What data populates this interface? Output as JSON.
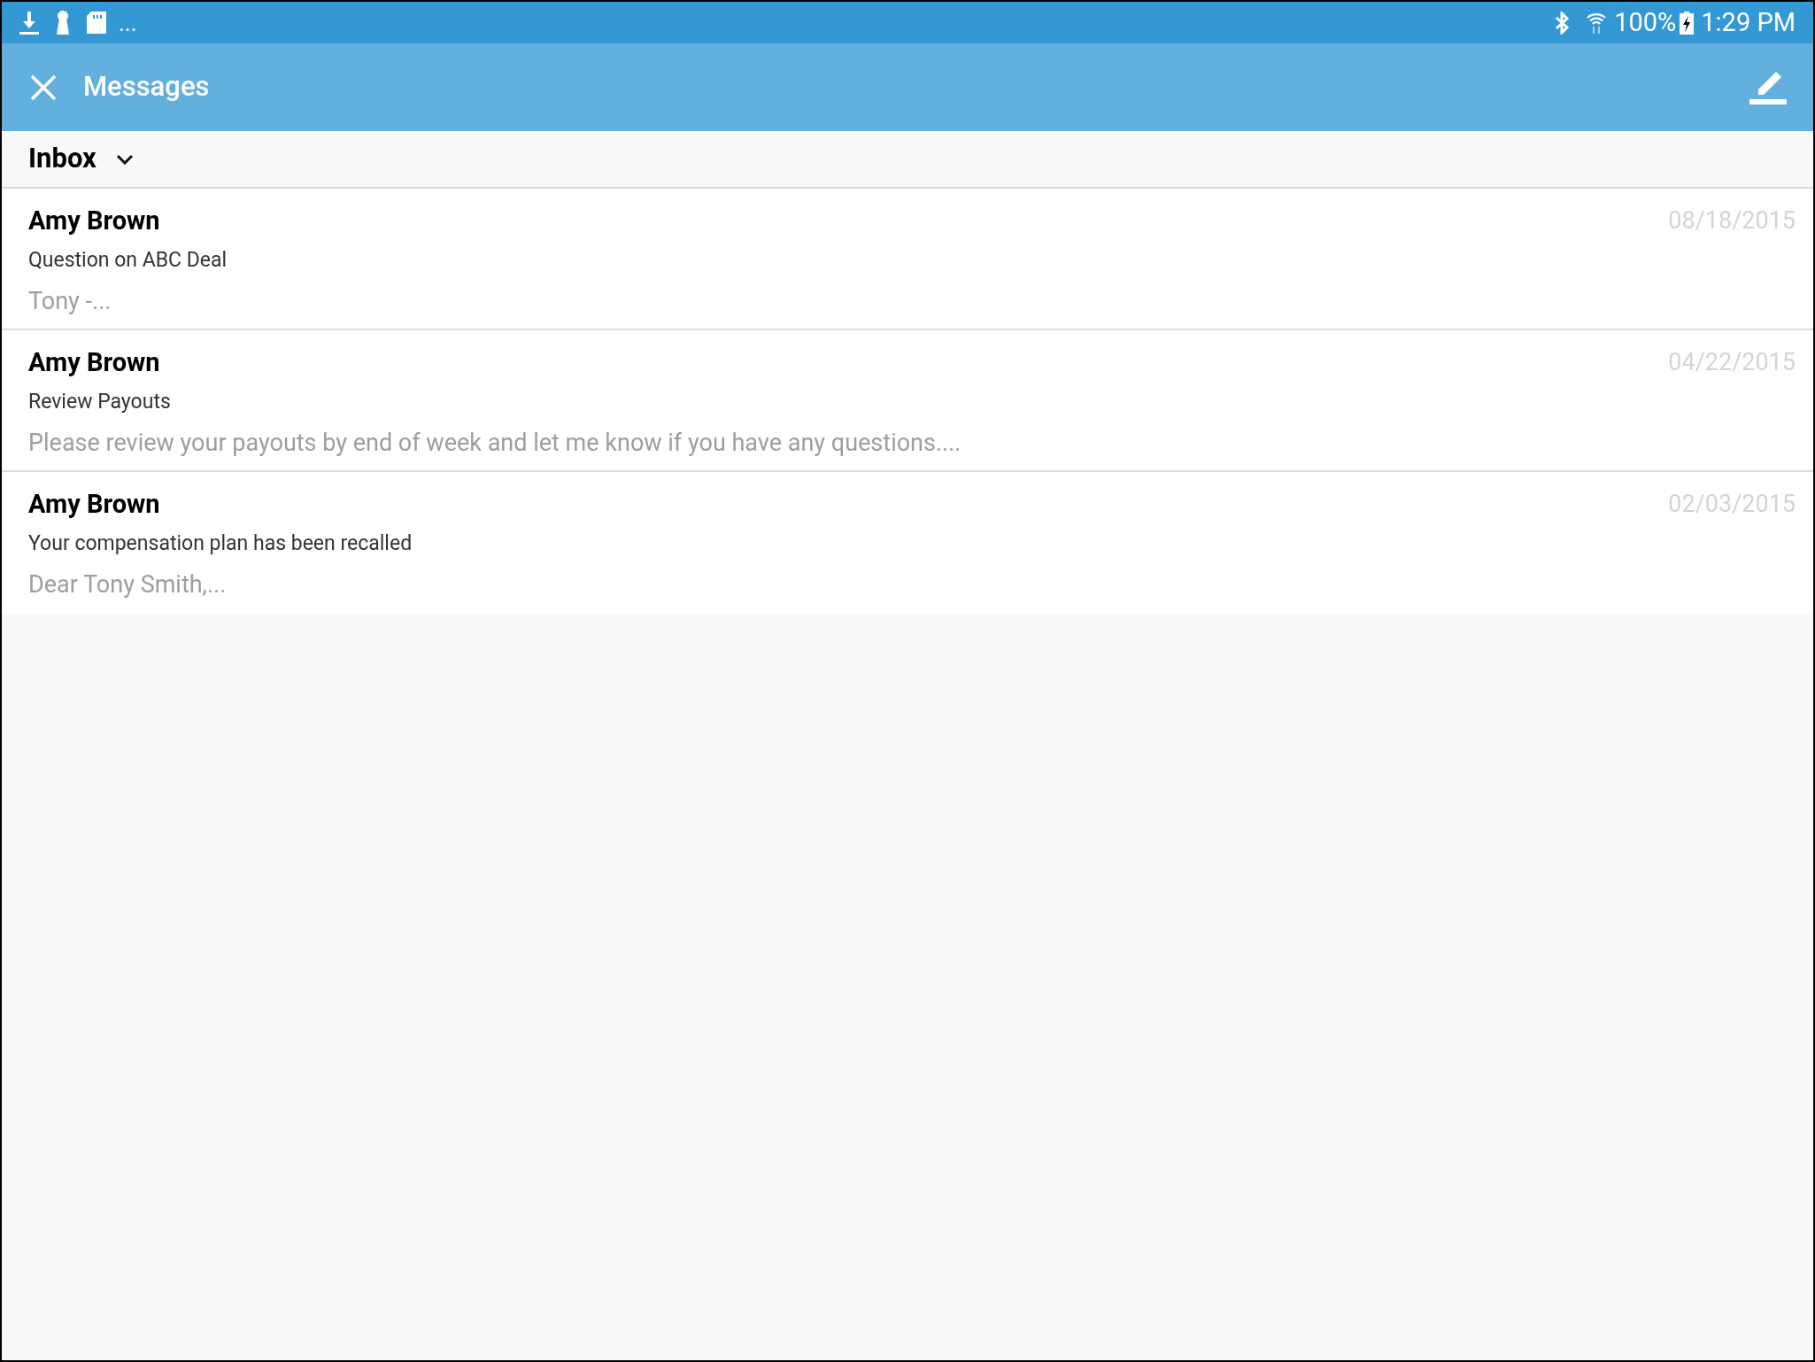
{
  "status_bar": {
    "more": "...",
    "battery": "100%",
    "time": "1:29 PM"
  },
  "header": {
    "title": "Messages"
  },
  "folder": {
    "label": "Inbox"
  },
  "messages": [
    {
      "sender": "Amy Brown",
      "date": "08/18/2015",
      "subject": "Question on ABC Deal",
      "preview": "Tony -..."
    },
    {
      "sender": "Amy Brown",
      "date": "04/22/2015",
      "subject": "Review Payouts",
      "preview": "Please review your payouts by end of week and let me know if you have any questions...."
    },
    {
      "sender": "Amy Brown",
      "date": "02/03/2015",
      "subject": "Your compensation plan has been recalled",
      "preview": "Dear Tony Smith,..."
    }
  ]
}
